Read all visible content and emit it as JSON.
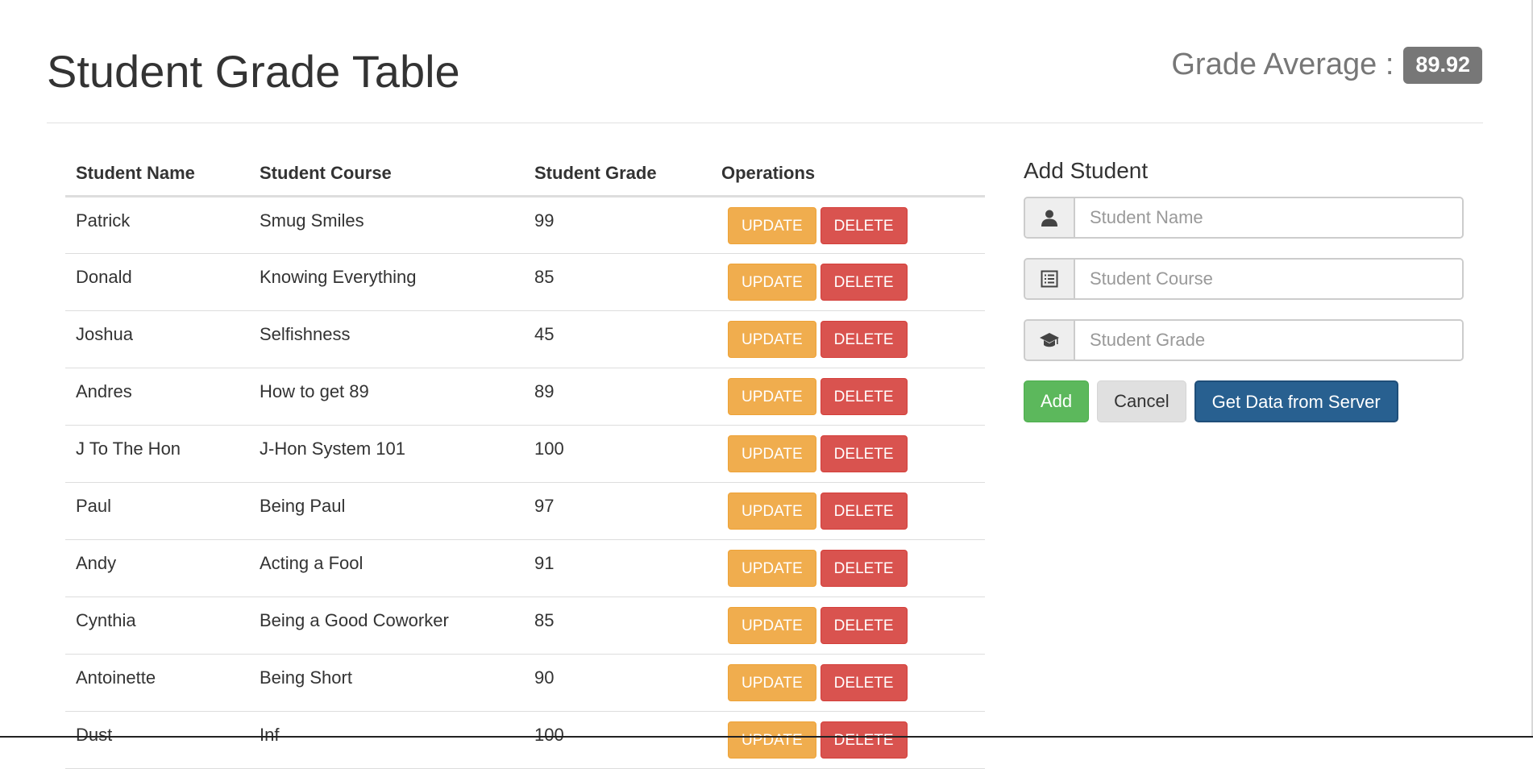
{
  "header": {
    "title": "Student Grade Table",
    "average_label": "Grade Average :",
    "average_value": "89.92"
  },
  "table": {
    "columns": [
      "Student Name",
      "Student Course",
      "Student Grade",
      "Operations"
    ],
    "update_label": "UPDATE",
    "delete_label": "DELETE",
    "rows": [
      {
        "name": "Patrick",
        "course": "Smug Smiles",
        "grade": "99"
      },
      {
        "name": "Donald",
        "course": "Knowing Everything",
        "grade": "85"
      },
      {
        "name": "Joshua",
        "course": "Selfishness",
        "grade": "45"
      },
      {
        "name": "Andres",
        "course": "How to get 89",
        "grade": "89"
      },
      {
        "name": "J To The Hon",
        "course": "J-Hon System 101",
        "grade": "100"
      },
      {
        "name": "Paul",
        "course": "Being Paul",
        "grade": "97"
      },
      {
        "name": "Andy",
        "course": "Acting a Fool",
        "grade": "91"
      },
      {
        "name": "Cynthia",
        "course": "Being a Good Coworker",
        "grade": "85"
      },
      {
        "name": "Antoinette",
        "course": "Being Short",
        "grade": "90"
      },
      {
        "name": "Dust",
        "course": "Inf",
        "grade": "100"
      }
    ]
  },
  "form": {
    "title": "Add Student",
    "name_placeholder": "Student Name",
    "course_placeholder": "Student Course",
    "grade_placeholder": "Student Grade",
    "name_icon": "user-icon",
    "course_icon": "list-icon",
    "grade_icon": "graduation-cap-icon",
    "add_label": "Add",
    "cancel_label": "Cancel",
    "server_label": "Get Data from Server"
  },
  "colors": {
    "warning": "#f0ad4e",
    "danger": "#d9534f",
    "success": "#5cb85c",
    "primary": "#286090",
    "badge": "#777777"
  }
}
